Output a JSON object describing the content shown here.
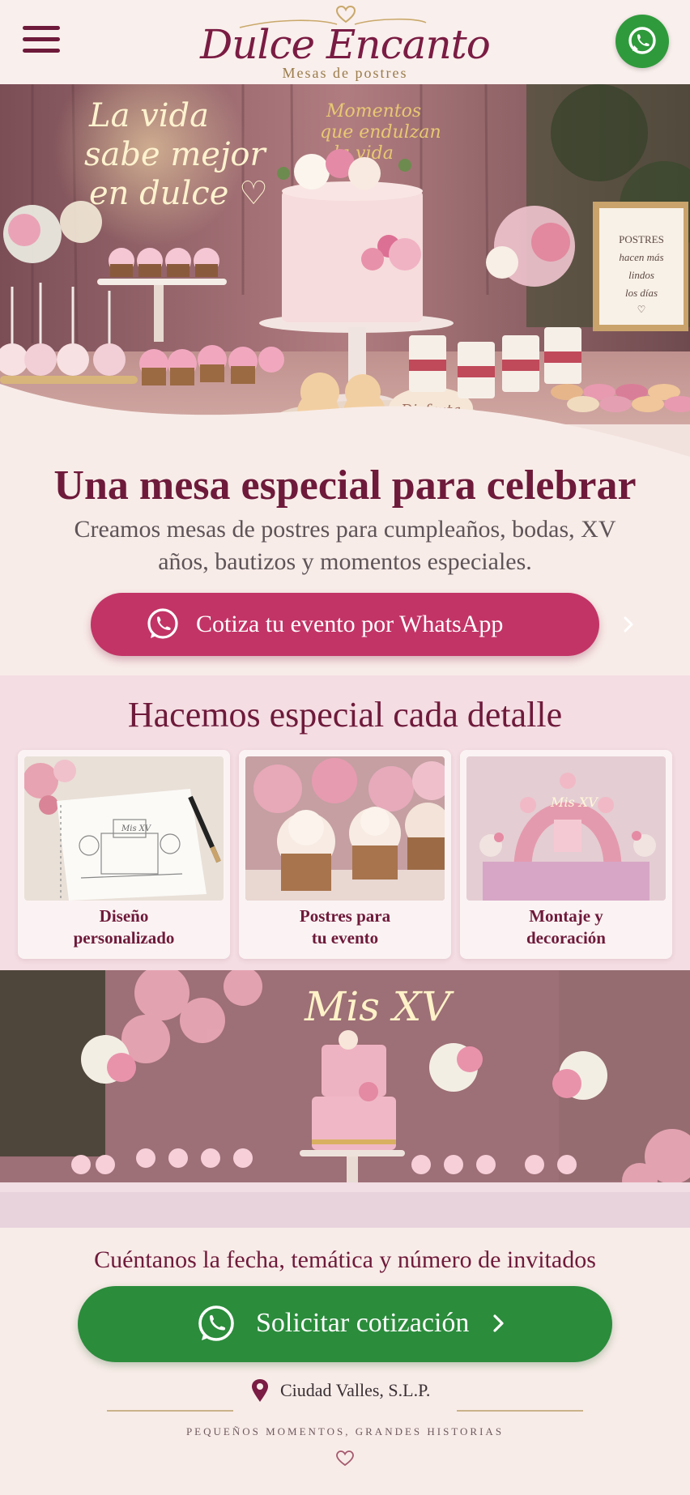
{
  "header": {
    "brand_name": "Dulce Encanto",
    "brand_tagline": "Mesas de postres",
    "menu_icon": "hamburger-menu-icon",
    "whatsapp_icon": "whatsapp-icon"
  },
  "hero": {
    "neon_sign": [
      "La vida",
      "sabe mejor",
      "en dulce ♡"
    ],
    "cake_topper": [
      "Momentos",
      "que endulzan",
      "la vida"
    ],
    "frame_text": [
      "POSTRES",
      "hacen más",
      "lindos",
      "los días",
      "♡"
    ],
    "cookie_text": "Disfruta"
  },
  "intro": {
    "title": "Una mesa especial para celebrar",
    "subtitle": "Creamos mesas de postres para cumpleaños, bodas, XV años, bautizos y momentos especiales.",
    "cta_label": "Cotiza tu evento por WhatsApp"
  },
  "features": {
    "title": "Hacemos especial cada detalle",
    "cards": [
      {
        "label_line1": "Diseño",
        "label_line2": "personalizado",
        "sketch_text": "Mis XV"
      },
      {
        "label_line1": "Postres para",
        "label_line2": "tu evento"
      },
      {
        "label_line1": "Montaje y",
        "label_line2": "decoración",
        "neon_text": "Mis XV"
      }
    ]
  },
  "gallery": {
    "neon_text": "Mis XV"
  },
  "contact": {
    "prompt": "Cuéntanos la fecha, temática y número de invitados",
    "cta_label": "Solicitar cotización",
    "location": "Ciudad Valles, S.L.P.",
    "tagline": "PEQUEÑOS MOMENTOS, GRANDES HISTORIAS"
  },
  "colors": {
    "burgundy": "#6e1a3a",
    "rose_button": "#c23466",
    "whatsapp_green": "#2b8c3c",
    "gold": "#c9b28a",
    "background": "#f8ece8"
  }
}
